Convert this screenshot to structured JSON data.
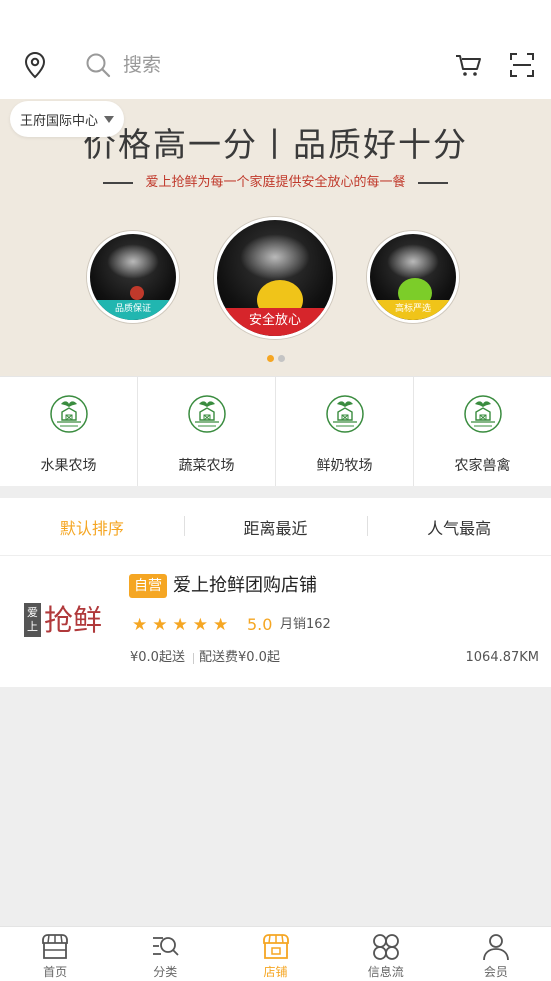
{
  "header": {
    "search_placeholder": "搜索"
  },
  "location": {
    "name": "王府国际中心"
  },
  "banner": {
    "title": "价格高一分丨品质好十分",
    "subtitle": "爱上抢鲜为每一个家庭提供安全放心的每一餐",
    "badges": [
      "品质保证",
      "安全放心",
      "高标严选"
    ],
    "slide_count": 2,
    "active_slide": 1
  },
  "categories": [
    {
      "label": "水果农场"
    },
    {
      "label": "蔬菜农场"
    },
    {
      "label": "鲜奶牧场"
    },
    {
      "label": "农家兽禽"
    }
  ],
  "sort_tabs": [
    {
      "label": "默认排序",
      "active": true
    },
    {
      "label": "距离最近",
      "active": false
    },
    {
      "label": "人气最高",
      "active": false
    }
  ],
  "store": {
    "logo_box_text": "爱上",
    "logo_text": "抢鲜",
    "badge": "自营",
    "name": "爱上抢鲜团购店铺",
    "stars": 5,
    "rating": "5.0",
    "sales": "月销162",
    "min_order": "¥0.0起送",
    "delivery_fee": "配送费¥0.0起",
    "distance": "1064.87KM"
  },
  "bottom_nav": [
    {
      "label": "首页",
      "icon": "home-icon",
      "active": false
    },
    {
      "label": "分类",
      "icon": "category-search-icon",
      "active": false
    },
    {
      "label": "店铺",
      "icon": "store-icon",
      "active": true
    },
    {
      "label": "信息流",
      "icon": "grid-flow-icon",
      "active": false
    },
    {
      "label": "会员",
      "icon": "user-icon",
      "active": false
    }
  ],
  "colors": {
    "accent": "#f5a623",
    "brand_red": "#b0393b",
    "banner_bg": "#efe9df"
  }
}
